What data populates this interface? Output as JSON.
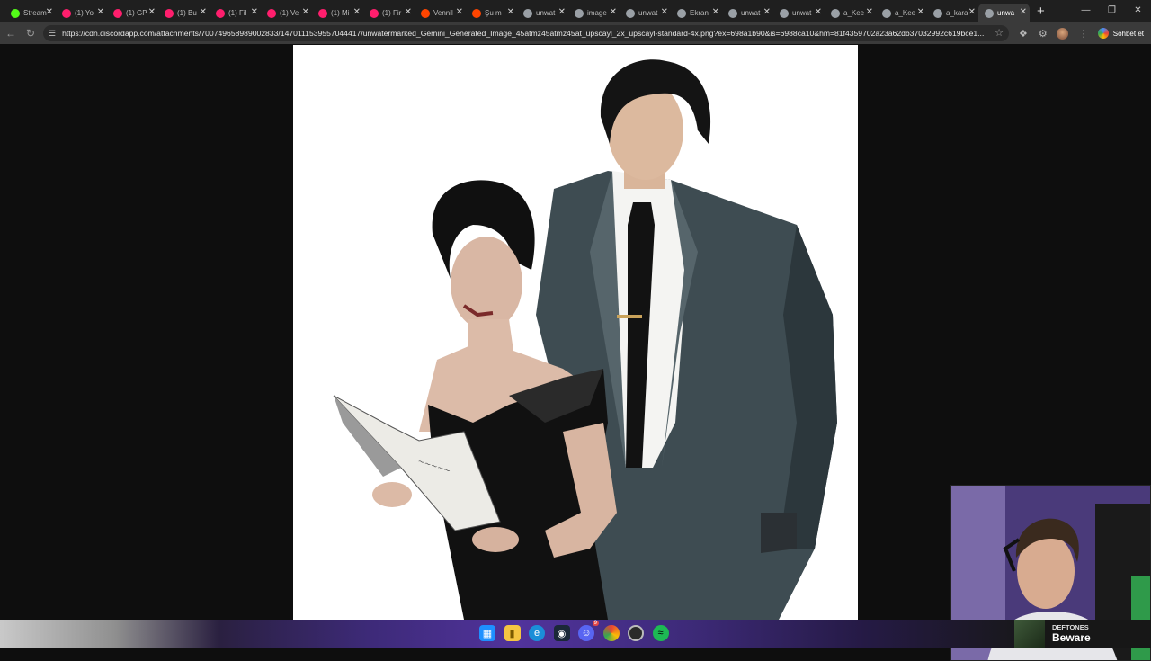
{
  "browser": {
    "tabs": [
      {
        "label": "Stream",
        "icon_color": "#53fc18",
        "active": false
      },
      {
        "label": "(1) Yo",
        "icon_color": "#ff1e6d",
        "active": false
      },
      {
        "label": "(1) GP",
        "icon_color": "#ff1e6d",
        "active": false
      },
      {
        "label": "(1) Bu",
        "icon_color": "#ff1e6d",
        "active": false
      },
      {
        "label": "(1) Fil",
        "icon_color": "#ff1e6d",
        "active": false
      },
      {
        "label": "(1) Ve",
        "icon_color": "#ff1e6d",
        "active": false
      },
      {
        "label": "(1) Mi",
        "icon_color": "#ff1e6d",
        "active": false
      },
      {
        "label": "(1) Fir",
        "icon_color": "#ff1e6d",
        "active": false
      },
      {
        "label": "Vennil",
        "icon_color": "#ff4500",
        "active": false
      },
      {
        "label": "Şu m",
        "icon_color": "#ff4500",
        "active": false
      },
      {
        "label": "unwat",
        "icon_color": "#9aa0a6",
        "active": false
      },
      {
        "label": "image",
        "icon_color": "#9aa0a6",
        "active": false
      },
      {
        "label": "unwat",
        "icon_color": "#9aa0a6",
        "active": false
      },
      {
        "label": "Ekran",
        "icon_color": "#9aa0a6",
        "active": false
      },
      {
        "label": "unwat",
        "icon_color": "#9aa0a6",
        "active": false
      },
      {
        "label": "unwat",
        "icon_color": "#9aa0a6",
        "active": false
      },
      {
        "label": "a_Kee",
        "icon_color": "#9aa0a6",
        "active": false
      },
      {
        "label": "a_Kee",
        "icon_color": "#9aa0a6",
        "active": false
      },
      {
        "label": "a_kara",
        "icon_color": "#9aa0a6",
        "active": false
      },
      {
        "label": "unwa",
        "icon_color": "#9aa0a6",
        "active": true
      }
    ],
    "new_tab": "+",
    "url": "https://cdn.discordapp.com/attachments/700749658989002833/1470111539557044417/unwatermarked_Gemini_Generated_Image_45atmz45atmz45at_upscayl_2x_upscayl-standard-4x.png?ex=698a1b90&is=6988ca10&hm=81f4359702a23a62db37032992c619bce1...",
    "chat_button": "Sohbet et"
  },
  "taskbar": {
    "apps": [
      "windows-start",
      "file-explorer",
      "edge",
      "steam",
      "discord",
      "chrome",
      "obs",
      "spotify"
    ],
    "discord_badge": "9"
  },
  "now_playing": {
    "artist": "DEFTONES",
    "track": "Beware"
  }
}
